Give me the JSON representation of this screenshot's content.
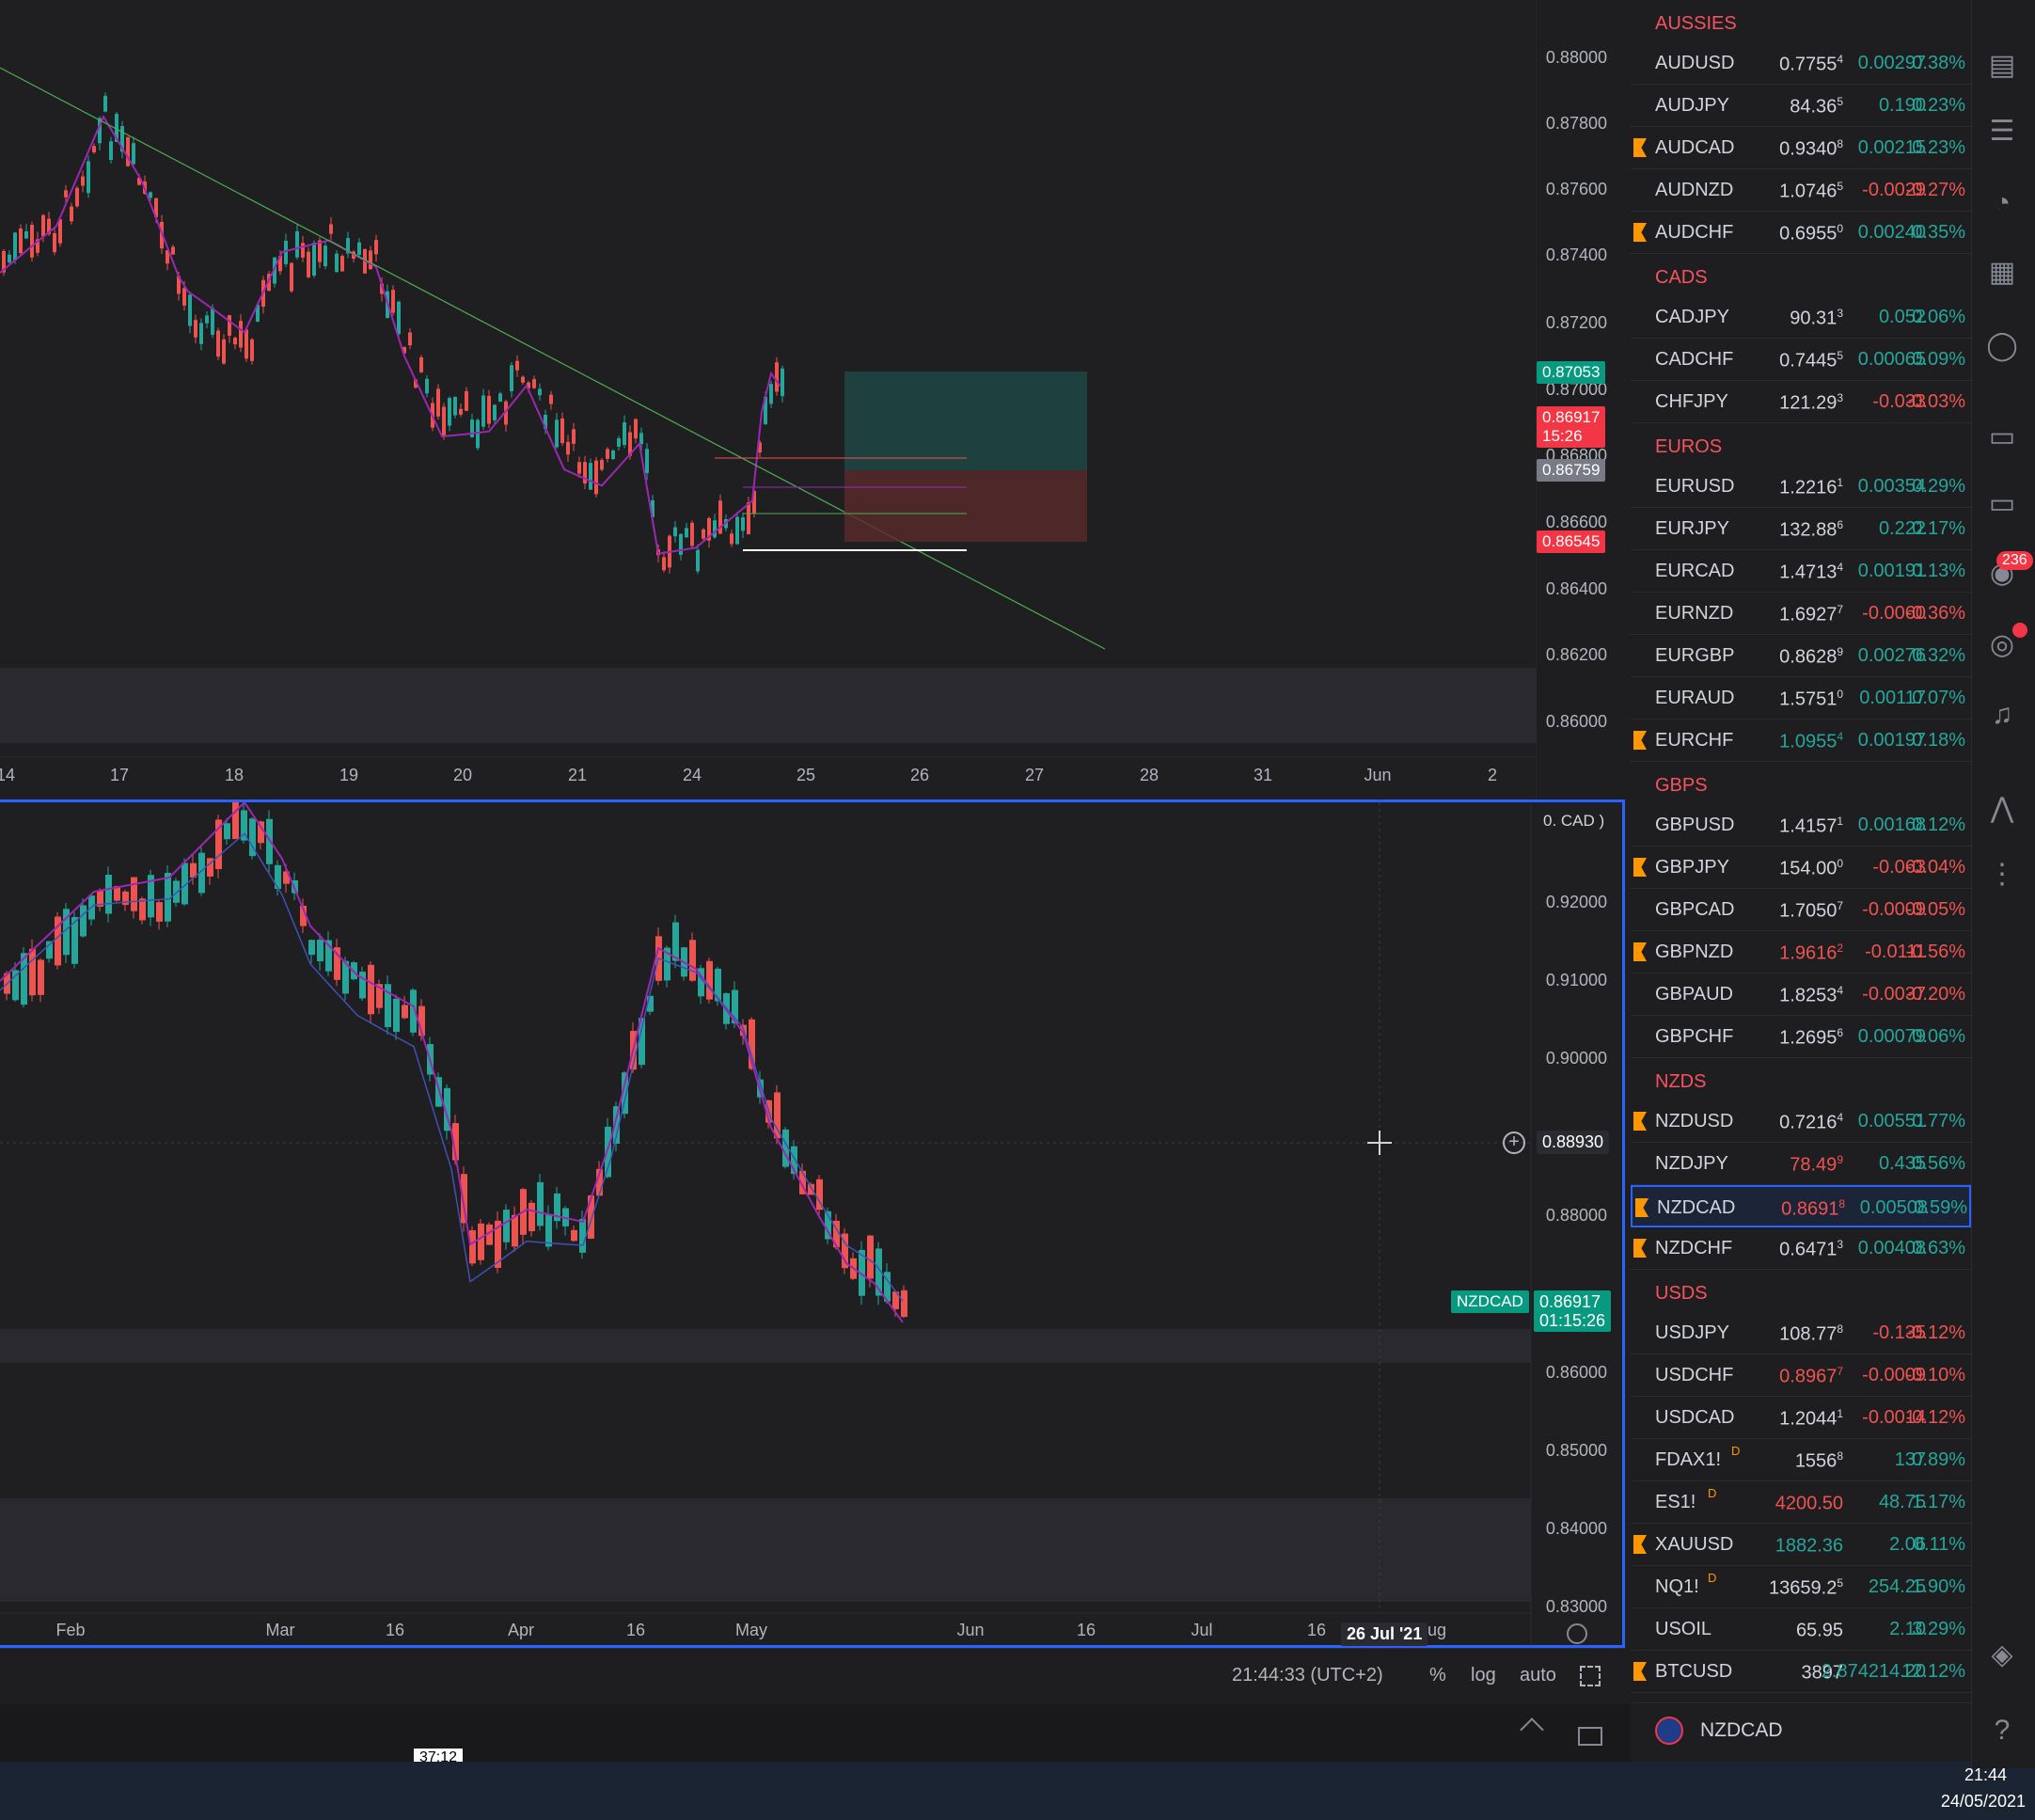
{
  "top_chart": {
    "price_axis": [
      "0.88000",
      "0.87800",
      "0.87600",
      "0.87400",
      "0.87200",
      "0.87000",
      "0.86800",
      "0.86600",
      "0.86400",
      "0.86200",
      "0.86000"
    ],
    "time_axis": [
      "14",
      "17",
      "18",
      "19",
      "20",
      "21",
      "24",
      "25",
      "26",
      "27",
      "28",
      "31",
      "Jun",
      "2"
    ],
    "tags": {
      "current_a": "0.87053",
      "current_b": "0.86917",
      "countdown": "15:26",
      "level_grey": "0.86759",
      "level_red": "0.86545"
    }
  },
  "bottom_chart": {
    "currency_label": "0. CAD )",
    "price_axis": [
      "0.92000",
      "0.91000",
      "0.90000",
      "0.88000",
      "0.86000",
      "0.85000",
      "0.84000",
      "0.83000"
    ],
    "time_axis": [
      "Feb",
      "Mar",
      "16",
      "Apr",
      "16",
      "May",
      "Jun",
      "16",
      "Jul",
      "16",
      "ug"
    ],
    "date_cursor": "26 Jul '21",
    "crosshair_price": "0.88930",
    "symbol_tag": "NZDCAD",
    "last_price": "0.86917",
    "countdown": "01:15:26",
    "partial_label": "0.87000"
  },
  "toolbar": {
    "time": "21:44:33 (UTC+2)",
    "percent": "%",
    "log": "log",
    "auto": "auto"
  },
  "video": {
    "time_tooltip": "37:12",
    "progress": 0.53
  },
  "taskbar": {
    "clock": "21:44",
    "date": "24/05/2021"
  },
  "watchlist": {
    "sections": [
      {
        "title": "AUSSIES",
        "rows": [
          {
            "sym": "AUDUSD",
            "last": "0.7755",
            "sup": "4",
            "chg": "0.00297",
            "pct": "0.38%",
            "dir": "up",
            "flag": false
          },
          {
            "sym": "AUDJPY",
            "last": "84.36",
            "sup": "5",
            "chg": "0.190",
            "pct": "0.23%",
            "dir": "up",
            "flag": false
          },
          {
            "sym": "AUDCAD",
            "last": "0.9340",
            "sup": "8",
            "chg": "0.00215",
            "pct": "0.23%",
            "dir": "up",
            "flag": true
          },
          {
            "sym": "AUDNZD",
            "last": "1.0746",
            "sup": "5",
            "chg": "-0.0029",
            "pct": "-0.27%",
            "dir": "down",
            "flag": false
          },
          {
            "sym": "AUDCHF",
            "last": "0.6955",
            "sup": "0",
            "chg": "0.00240",
            "pct": "0.35%",
            "dir": "up",
            "flag": true
          }
        ]
      },
      {
        "title": "CADS",
        "rows": [
          {
            "sym": "CADJPY",
            "last": "90.31",
            "sup": "3",
            "chg": "0.052",
            "pct": "0.06%",
            "dir": "up",
            "flag": false
          },
          {
            "sym": "CADCHF",
            "last": "0.7445",
            "sup": "5",
            "chg": "0.00065",
            "pct": "0.09%",
            "dir": "up",
            "flag": false
          },
          {
            "sym": "CHFJPY",
            "last": "121.29",
            "sup": "3",
            "chg": "-0.033",
            "pct": "-0.03%",
            "dir": "down",
            "flag": false
          }
        ]
      },
      {
        "title": "EUROS",
        "rows": [
          {
            "sym": "EURUSD",
            "last": "1.2216",
            "sup": "1",
            "chg": "0.00354",
            "pct": "0.29%",
            "dir": "up",
            "flag": false
          },
          {
            "sym": "EURJPY",
            "last": "132.88",
            "sup": "6",
            "chg": "0.222",
            "pct": "0.17%",
            "dir": "up",
            "flag": false
          },
          {
            "sym": "EURCAD",
            "last": "1.4713",
            "sup": "4",
            "chg": "0.00191",
            "pct": "0.13%",
            "dir": "up",
            "flag": false
          },
          {
            "sym": "EURNZD",
            "last": "1.6927",
            "sup": "7",
            "chg": "-0.0060",
            "pct": "-0.36%",
            "dir": "down",
            "flag": false
          },
          {
            "sym": "EURGBP",
            "last": "0.8628",
            "sup": "9",
            "chg": "0.00276",
            "pct": "0.32%",
            "dir": "up",
            "flag": false
          },
          {
            "sym": "EURAUD",
            "last": "1.5751",
            "sup": "0",
            "chg": "0.00117",
            "pct": "0.07%",
            "dir": "up",
            "flag": false
          },
          {
            "sym": "EURCHF",
            "last": "1.0955",
            "sup": "4",
            "chg": "0.00197",
            "pct": "0.18%",
            "dir": "up",
            "flag": true,
            "lastColor": "up"
          }
        ]
      },
      {
        "title": "GBPS",
        "rows": [
          {
            "sym": "GBPUSD",
            "last": "1.4157",
            "sup": "1",
            "chg": "0.00168",
            "pct": "0.12%",
            "dir": "up",
            "flag": false
          },
          {
            "sym": "GBPJPY",
            "last": "154.00",
            "sup": "0",
            "chg": "-0.063",
            "pct": "-0.04%",
            "dir": "down",
            "flag": true
          },
          {
            "sym": "GBPCAD",
            "last": "1.7050",
            "sup": "7",
            "chg": "-0.0009",
            "pct": "-0.05%",
            "dir": "down",
            "flag": false
          },
          {
            "sym": "GBPNZD",
            "last": "1.9616",
            "sup": "2",
            "chg": "-0.0111",
            "pct": "-0.56%",
            "dir": "down",
            "flag": true,
            "lastColor": "down"
          },
          {
            "sym": "GBPAUD",
            "last": "1.8253",
            "sup": "4",
            "chg": "-0.0037",
            "pct": "-0.20%",
            "dir": "down",
            "flag": false
          },
          {
            "sym": "GBPCHF",
            "last": "1.2695",
            "sup": "6",
            "chg": "0.00079",
            "pct": "0.06%",
            "dir": "up",
            "flag": false
          }
        ]
      },
      {
        "title": "NZDS",
        "rows": [
          {
            "sym": "NZDUSD",
            "last": "0.7216",
            "sup": "4",
            "chg": "0.00551",
            "pct": "0.77%",
            "dir": "up",
            "flag": true
          },
          {
            "sym": "NZDJPY",
            "last": "78.49",
            "sup": "9",
            "chg": "0.435",
            "pct": "0.56%",
            "dir": "up",
            "flag": false,
            "lastColor": "down"
          },
          {
            "sym": "NZDCAD",
            "last": "0.8691",
            "sup": "8",
            "chg": "0.00508",
            "pct": "0.59%",
            "dir": "up",
            "flag": true,
            "lastColor": "down",
            "selected": true
          },
          {
            "sym": "NZDCHF",
            "last": "0.6471",
            "sup": "3",
            "chg": "0.00408",
            "pct": "0.63%",
            "dir": "up",
            "flag": true
          }
        ]
      },
      {
        "title": "USDS",
        "rows": [
          {
            "sym": "USDJPY",
            "last": "108.77",
            "sup": "8",
            "chg": "-0.135",
            "pct": "-0.12%",
            "dir": "down",
            "flag": false
          },
          {
            "sym": "USDCHF",
            "last": "0.8967",
            "sup": "7",
            "chg": "-0.0009",
            "pct": "-0.10%",
            "dir": "down",
            "flag": false,
            "lastColor": "down"
          },
          {
            "sym": "USDCAD",
            "last": "1.2044",
            "sup": "1",
            "chg": "-0.0014",
            "pct": "-0.12%",
            "dir": "down",
            "flag": false
          },
          {
            "sym": "FDAX1!",
            "last": "1556",
            "sup": "8",
            "chg": "137",
            "pct": "0.89%",
            "dir": "up",
            "flag": false,
            "dmark": "D"
          },
          {
            "sym": "ES1!",
            "last": "4200.50",
            "sup": "",
            "chg": "48.75",
            "pct": "1.17%",
            "dir": "up",
            "flag": false,
            "dmark": "D",
            "lastColor": "down"
          },
          {
            "sym": "XAUUSD",
            "last": "1882.36",
            "sup": "",
            "chg": "2.06",
            "pct": "0.11%",
            "dir": "up",
            "flag": true,
            "lastColor": "up"
          },
          {
            "sym": "NQ1!",
            "last": "13659.2",
            "sup": "5",
            "chg": "254.25",
            "pct": "1.90%",
            "dir": "up",
            "flag": false,
            "dmark": "D"
          },
          {
            "sym": "USOIL",
            "last": "65.95",
            "sup": "",
            "chg": "2.10",
            "pct": "3.29%",
            "dir": "up",
            "flag": false
          },
          {
            "sym": "BTCUSD",
            "last": "3897",
            "sup": "",
            "chg": "2.874214.20",
            "pct": "12.12%",
            "dir": "up",
            "flag": true,
            "lastColor": "neutral"
          }
        ]
      }
    ],
    "footer_symbol": "NZDCAD",
    "notification_count": "236"
  },
  "colors": {
    "up": "#26a69a",
    "down": "#ef5350",
    "accent": "#2962ff",
    "section": "#f7525f",
    "flag": "#ff9800"
  }
}
